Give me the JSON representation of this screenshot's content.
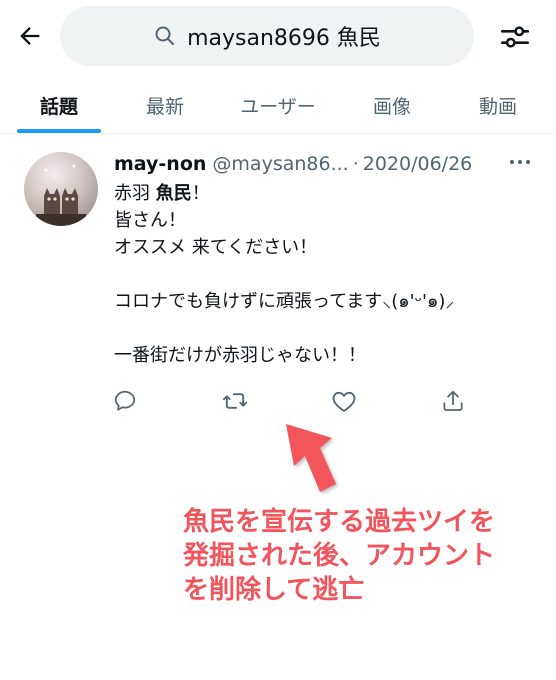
{
  "search": {
    "query": "maysan8696 魚民"
  },
  "tabs": [
    {
      "label": "話題",
      "active": true
    },
    {
      "label": "最新",
      "active": false
    },
    {
      "label": "ユーザー",
      "active": false
    },
    {
      "label": "画像",
      "active": false
    },
    {
      "label": "動画",
      "active": false
    }
  ],
  "tweet": {
    "display_name": "may-non",
    "handle": "@maysan86...",
    "separator": "·",
    "date": "2020/06/26",
    "lines": [
      {
        "prefix": "赤羽 ",
        "bold": "魚民",
        "suffix": "！"
      },
      {
        "text": "皆さん！"
      },
      {
        "text": "オススメ 来てください！"
      },
      {
        "text": ""
      },
      {
        "text": "コロナでも負けずに頑張ってます⸜(๑'ᵕ'๑)⸝"
      },
      {
        "text": ""
      },
      {
        "text": "一番街だけが赤羽じゃない！！"
      }
    ],
    "actions": [
      "reply-icon",
      "retweet-icon",
      "like-icon",
      "share-icon"
    ]
  },
  "annotation": {
    "lines": [
      "魚民を宣伝する過去ツイを",
      "発掘された後、アカウント",
      "を削除して逃亡"
    ],
    "color": "#f2545b"
  },
  "colors": {
    "accent": "#1d9bf0",
    "secondary_text": "#536471",
    "search_bg": "#eff3f4"
  }
}
